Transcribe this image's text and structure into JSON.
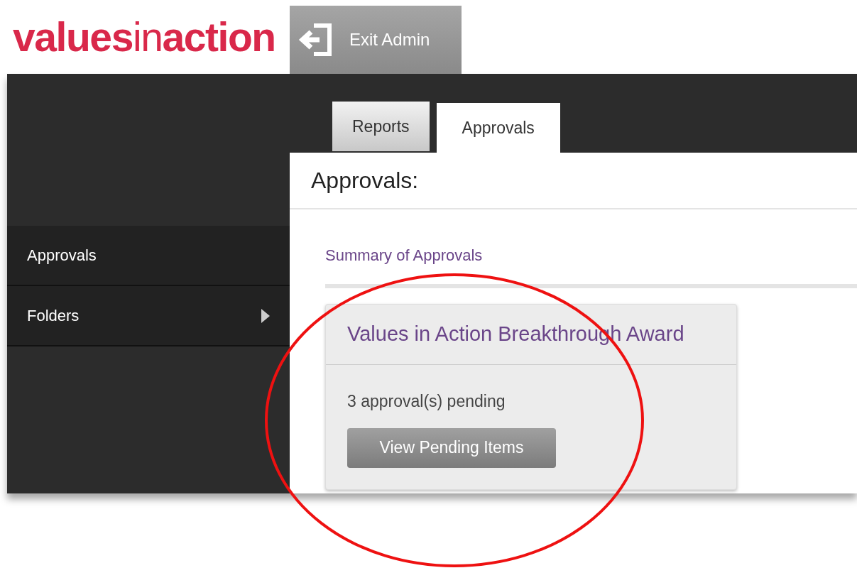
{
  "header": {
    "logo": "**values**in**action**",
    "exit_button": "Exit Admin"
  },
  "sidebar": {
    "items": [
      {
        "label": "Approvals",
        "has_children": false
      },
      {
        "label": "Folders",
        "has_children": true
      }
    ]
  },
  "tabs": [
    {
      "label": "Reports",
      "selected": false
    },
    {
      "label": "Approvals",
      "selected": true
    }
  ],
  "panel": {
    "title": "Approvals:",
    "summary_link": "Summary of Approvals",
    "card": {
      "title": "Values in Action Breakthrough Award",
      "status": "3 approval(s) pending",
      "button": "View Pending Items"
    }
  }
}
